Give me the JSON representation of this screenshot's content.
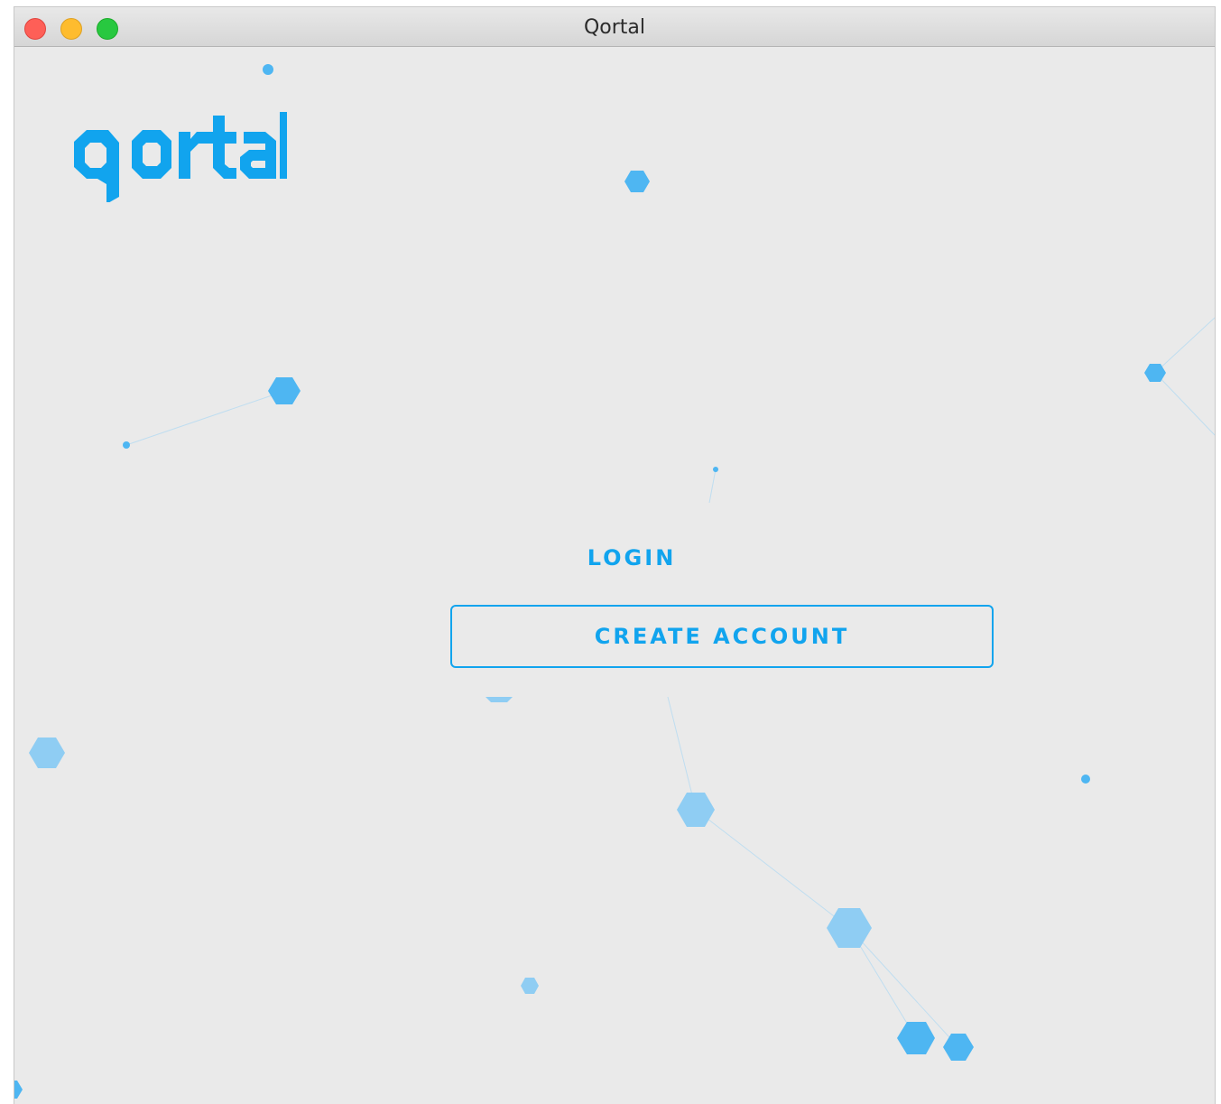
{
  "window": {
    "title": "Qortal"
  },
  "logo": {
    "text": "qortal"
  },
  "auth": {
    "login_label": "LOGIN",
    "create_account_label": "CREATE ACCOUNT"
  },
  "colors": {
    "brand": "#11a4ee",
    "background": "#eaeaea",
    "particle": "#4eb6f2"
  }
}
